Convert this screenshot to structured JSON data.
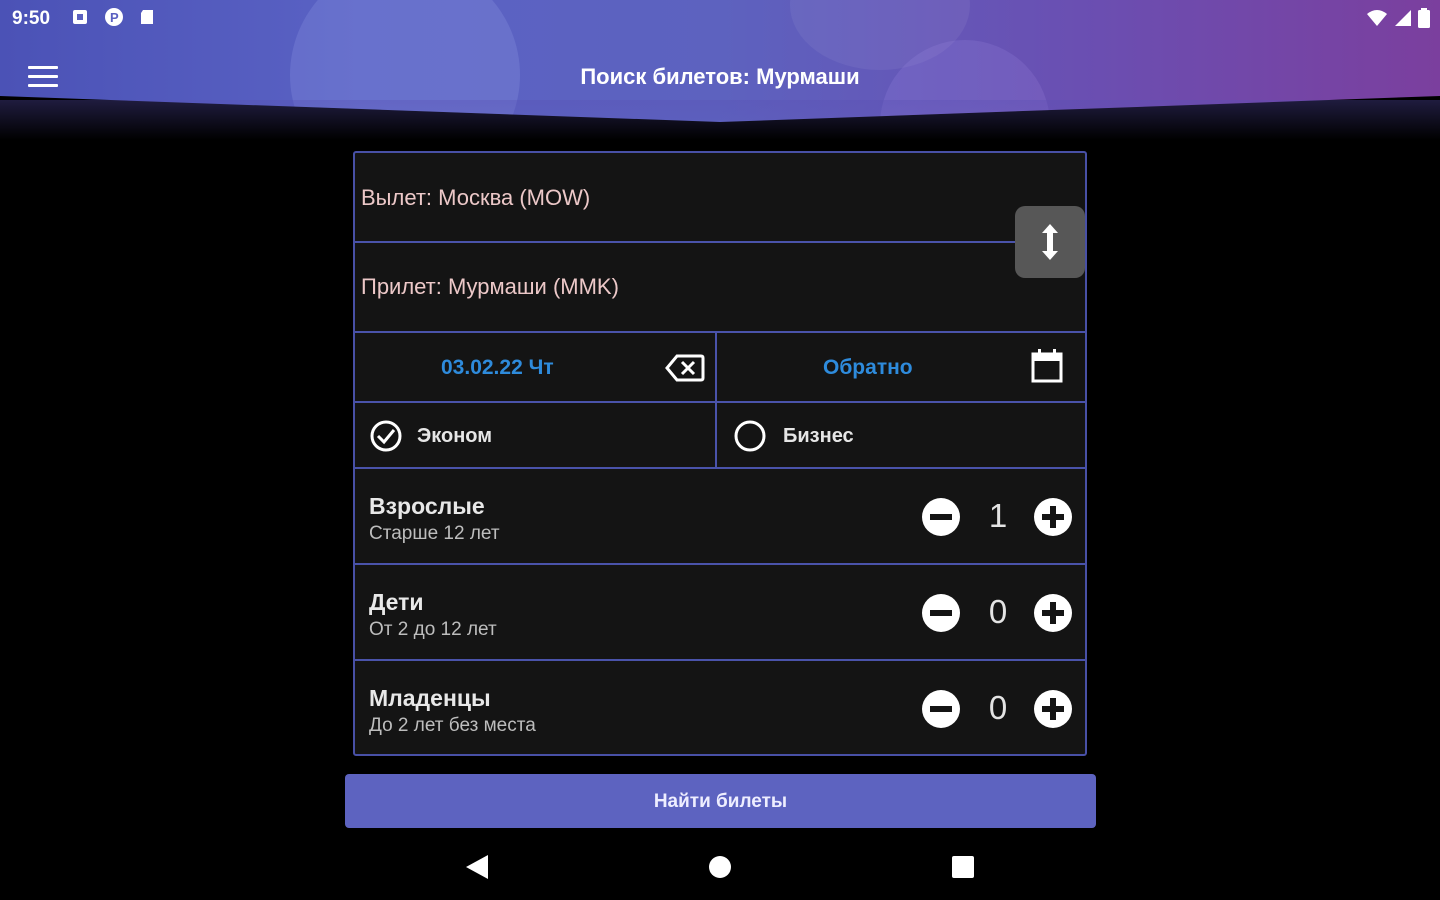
{
  "status": {
    "time": "9:50",
    "left_icons": [
      "sim-card-icon",
      "p-badge-icon",
      "sd-card-icon"
    ],
    "right_icons": [
      "wifi-icon",
      "signal-icon",
      "battery-icon"
    ]
  },
  "header": {
    "title": "Поиск билетов: Мурмаши",
    "menu_icon": "hamburger-menu-icon"
  },
  "route": {
    "departure": "Вылет: Москва (MOW)",
    "arrival": "Прилет: Мурмаши (MMK)",
    "swap_icon": "swap-vertical-icon"
  },
  "dates": {
    "outbound": "03.02.22 Чт",
    "clear_icon": "backspace-clear-icon",
    "return": "Обратно",
    "calendar_icon": "calendar-icon"
  },
  "class": {
    "economy": "Эконом",
    "business": "Бизнес",
    "selected": "economy"
  },
  "passengers": [
    {
      "title": "Взрослые",
      "subtitle": "Старше 12 лет",
      "count": "1"
    },
    {
      "title": "Дети",
      "subtitle": "От 2 до 12 лет",
      "count": "0"
    },
    {
      "title": "Младенцы",
      "subtitle": "До 2 лет без места",
      "count": "0"
    }
  ],
  "search_button": "Найти билеты",
  "navbar": [
    "back-icon",
    "home-icon",
    "recents-icon"
  ],
  "colors": {
    "accent": "#5d63c0",
    "border": "#4a53aa",
    "date_text": "#2e8bdc",
    "card_bg": "#141414"
  }
}
